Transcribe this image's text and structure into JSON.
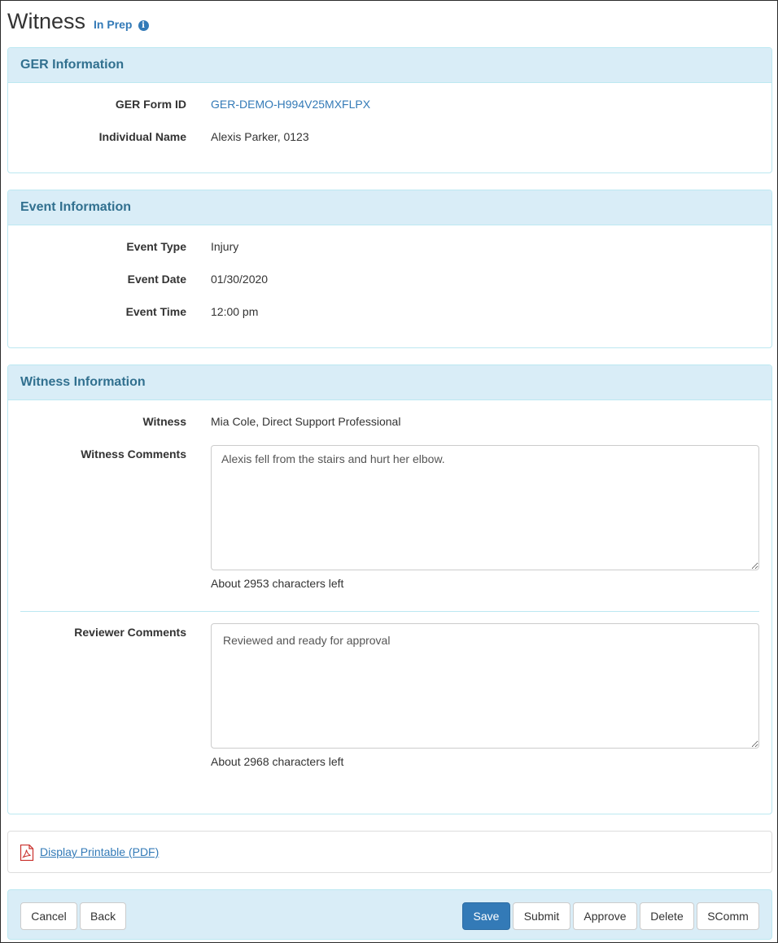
{
  "header": {
    "title": "Witness",
    "status": "In Prep",
    "info_icon": "info-circle-icon"
  },
  "ger_panel": {
    "heading": "GER Information",
    "form_id_label": "GER Form ID",
    "form_id_value": "GER-DEMO-H994V25MXFLPX",
    "individual_label": "Individual Name",
    "individual_value": "Alexis Parker, 0123"
  },
  "event_panel": {
    "heading": "Event Information",
    "type_label": "Event Type",
    "type_value": "Injury",
    "date_label": "Event Date",
    "date_value": "01/30/2020",
    "time_label": "Event Time",
    "time_value": "12:00 pm"
  },
  "witness_panel": {
    "heading": "Witness Information",
    "witness_label": "Witness",
    "witness_value": "Mia Cole, Direct Support Professional",
    "comments_label": "Witness Comments",
    "comments_value": "Alexis fell from the stairs and hurt her elbow.",
    "comments_chars_left": "About 2953 characters left",
    "reviewer_label": "Reviewer Comments",
    "reviewer_value": "Reviewed and ready for approval",
    "reviewer_chars_left": "About 2968 characters left"
  },
  "printable": {
    "icon": "pdf-file-icon",
    "label": "Display Printable (PDF)"
  },
  "footer": {
    "cancel": "Cancel",
    "back": "Back",
    "save": "Save",
    "submit": "Submit",
    "approve": "Approve",
    "delete": "Delete",
    "scomm": "SComm"
  },
  "colors": {
    "accent": "#337ab7",
    "panel_heading_bg": "#d9edf7",
    "panel_heading_text": "#31708f",
    "panel_border": "#bce8f1",
    "pdf_icon": "#c9302c"
  }
}
